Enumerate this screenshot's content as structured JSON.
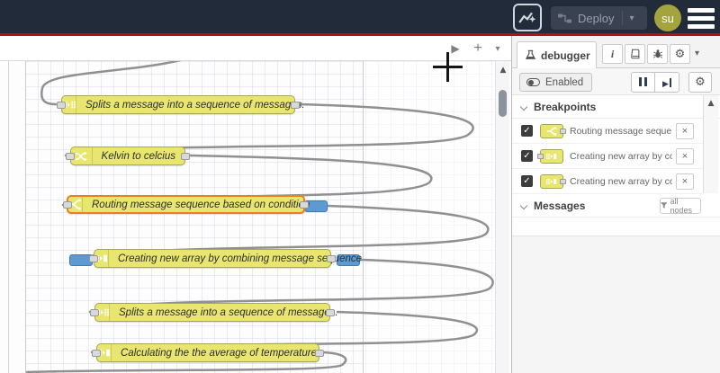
{
  "colors": {
    "header_bg": "#222b39",
    "header_accent_line": "#a9151f",
    "node_fill": "#e8e66f",
    "node_border": "#a6a653",
    "highlight_border": "#ee7d1e",
    "breakpoint_marker_blue": "#5b9ad2",
    "avatar_bg": "#a3a43e"
  },
  "header": {
    "deploy": {
      "label": "Deploy",
      "disabled": true
    },
    "avatar": {
      "label": "su"
    }
  },
  "canvas": {
    "nodes": [
      {
        "label": "Splits a message into a sequence of messages.",
        "type": "split"
      },
      {
        "label": "Kelvin to celcius",
        "type": "change"
      },
      {
        "label": "Routing message sequence based on condition",
        "type": "switch",
        "highlighted": true,
        "breakpoint_on_output": true
      },
      {
        "label": "Creating new array by combining message sequence",
        "type": "join",
        "breakpoint_on_input": true,
        "breakpoint_on_output": true
      },
      {
        "label": "Splits a message into a sequence of messages.",
        "type": "split"
      },
      {
        "label": "Calculating the the average of temperature",
        "type": "join"
      }
    ]
  },
  "sidebar": {
    "tab": {
      "label": "debugger"
    },
    "toolbar": {
      "enabled_label": "Enabled"
    },
    "breakpoints": {
      "title": "Breakpoints",
      "items": [
        {
          "label": "Routing message sequence based on condition",
          "checked": true,
          "node_type": "switch",
          "port": "output"
        },
        {
          "label": "Creating new array by combining message sequence",
          "checked": true,
          "node_type": "join",
          "port": "input"
        },
        {
          "label": "Creating new array by combining message sequence",
          "checked": true,
          "node_type": "join",
          "port": "output"
        }
      ]
    },
    "messages": {
      "title": "Messages",
      "filter_label": "all nodes"
    }
  },
  "icons": {
    "check": "✓",
    "close": "×",
    "up_triangle": "▲",
    "play": "▶",
    "plus": "+",
    "chevron_down": "▾",
    "gear": "⚙",
    "info": "i"
  }
}
